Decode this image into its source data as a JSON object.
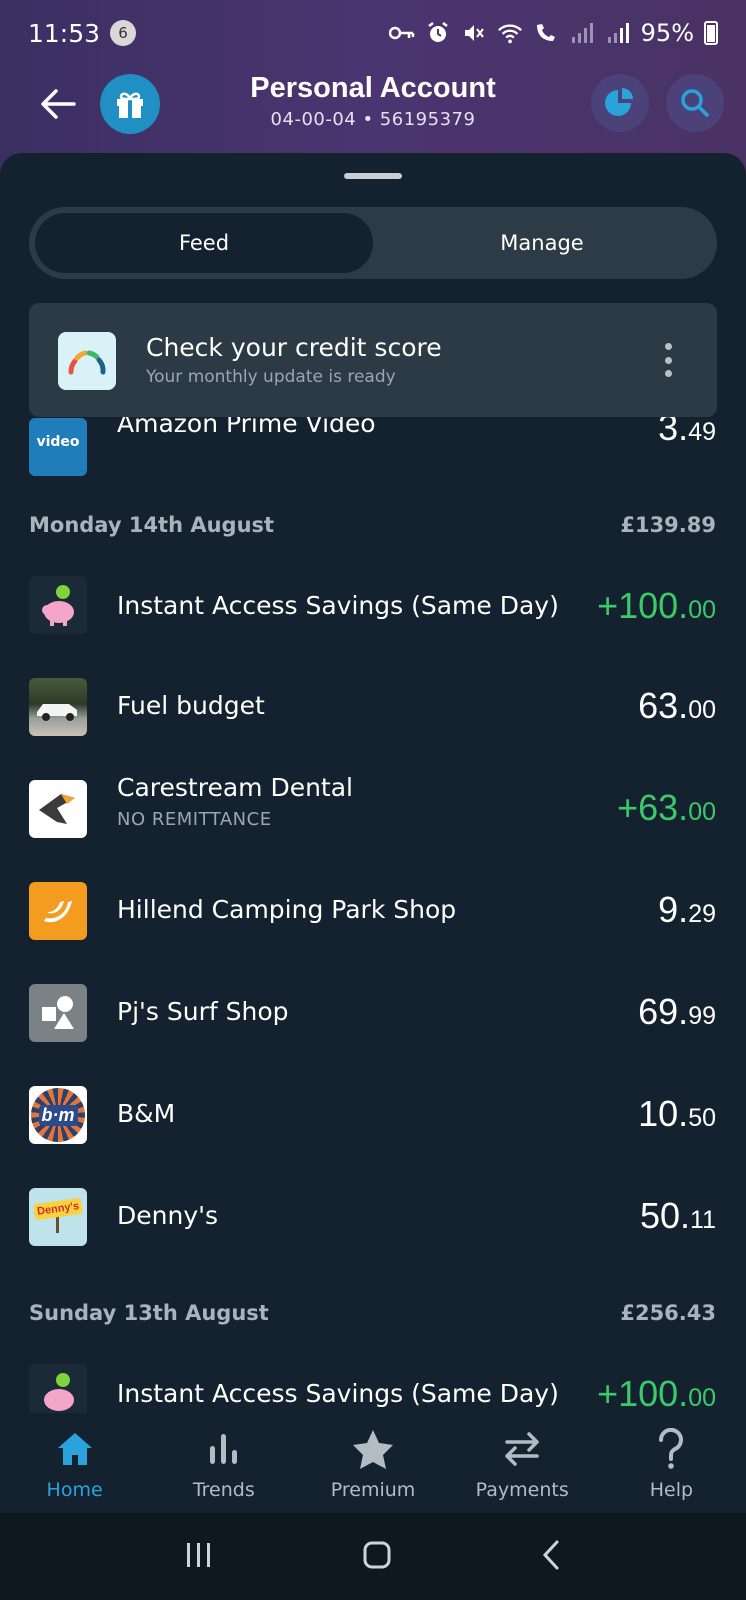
{
  "status_bar": {
    "time": "11:53",
    "notification_count": "6",
    "battery": "95%"
  },
  "header": {
    "title": "Personal Account",
    "subtitle": "04-00-04 • 56195379"
  },
  "tabs": [
    {
      "label": "Feed",
      "active": true
    },
    {
      "label": "Manage",
      "active": false
    }
  ],
  "promo": {
    "title": "Check your credit score",
    "subtitle": "Your monthly update is ready"
  },
  "partial_row": {
    "logo_text": "video",
    "merchant": "Amazon Prime Video",
    "amount_main": "3.",
    "amount_dec": "49"
  },
  "groups": [
    {
      "date": "Monday 14th August",
      "total": "£139.89",
      "transactions": [
        {
          "merchant": "Instant Access Savings (Same Day)",
          "sub": "",
          "amount_main": "+100.",
          "amount_dec": "00",
          "credit": true
        },
        {
          "merchant": "Fuel budget",
          "sub": "",
          "amount_main": "63.",
          "amount_dec": "00",
          "credit": false
        },
        {
          "merchant": "Carestream Dental",
          "sub": "NO REMITTANCE",
          "amount_main": "+63.",
          "amount_dec": "00",
          "credit": true
        },
        {
          "merchant": "Hillend Camping Park Shop",
          "sub": "",
          "amount_main": "9.",
          "amount_dec": "29",
          "credit": false
        },
        {
          "merchant": "Pj's Surf Shop",
          "sub": "",
          "amount_main": "69.",
          "amount_dec": "99",
          "credit": false
        },
        {
          "merchant": "B&M",
          "sub": "",
          "amount_main": "10.",
          "amount_dec": "50",
          "credit": false
        },
        {
          "merchant": "Denny's",
          "sub": "",
          "amount_main": "50.",
          "amount_dec": "11",
          "credit": false
        }
      ]
    },
    {
      "date": "Sunday 13th August",
      "total": "£256.43",
      "transactions": [
        {
          "merchant": "Instant Access Savings (Same Day)",
          "sub": "",
          "amount_main": "+100.",
          "amount_dec": "00",
          "credit": true
        }
      ]
    }
  ],
  "logo_labels": {
    "bm": "b·m",
    "dennys": "Denny's"
  },
  "bottom_nav": [
    {
      "label": "Home",
      "icon": "home-icon",
      "active": true
    },
    {
      "label": "Trends",
      "icon": "bar-chart-icon",
      "active": false
    },
    {
      "label": "Premium",
      "icon": "star-icon",
      "active": false
    },
    {
      "label": "Payments",
      "icon": "transfer-arrows-icon",
      "active": false
    },
    {
      "label": "Help",
      "icon": "question-icon",
      "active": false
    }
  ],
  "colors": {
    "accent": "#2aa3dd",
    "credit": "#3bc96a",
    "background": "#14222f"
  }
}
